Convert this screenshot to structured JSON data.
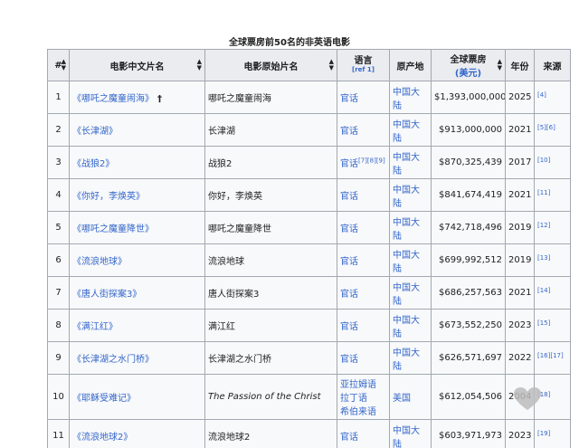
{
  "caption": "全球票房前50名的非英语电影",
  "headers": {
    "num": "#",
    "cn_title": "电影中文片名",
    "orig_title": "电影原始片名",
    "lang": "语言",
    "lang_ref": "[ref 1]",
    "country": "原产地",
    "gross": "全球票房",
    "gross_unit": "(美元)",
    "year": "年份",
    "source": "来源"
  },
  "rows": [
    {
      "n": "1",
      "cn": "《哪吒之魔童闹海》",
      "dagger": "†",
      "orig": "哪吒之魔童闹海",
      "lang": "官话",
      "lang_ref": "",
      "country": "中国大陆",
      "gross": "$1,393,000,000",
      "year": "2025",
      "ref": "[4]"
    },
    {
      "n": "2",
      "cn": "《长津湖》",
      "dagger": "",
      "orig": "长津湖",
      "lang": "官话",
      "lang_ref": "",
      "country": "中国大陆",
      "gross": "$913,000,000",
      "year": "2021",
      "ref": "[5][6]"
    },
    {
      "n": "3",
      "cn": "《战狼2》",
      "dagger": "",
      "orig": "战狼2",
      "lang": "官话",
      "lang_ref": "[7][8][9]",
      "country": "中国大陆",
      "gross": "$870,325,439",
      "year": "2017",
      "ref": "[10]"
    },
    {
      "n": "4",
      "cn": "《你好，李焕英》",
      "dagger": "",
      "orig": "你好，李焕英",
      "lang": "官话",
      "lang_ref": "",
      "country": "中国大陆",
      "gross": "$841,674,419",
      "year": "2021",
      "ref": "[11]"
    },
    {
      "n": "5",
      "cn": "《哪吒之魔童降世》",
      "dagger": "",
      "orig": "哪吒之魔童降世",
      "lang": "官话",
      "lang_ref": "",
      "country": "中国大陆",
      "gross": "$742,718,496",
      "year": "2019",
      "ref": "[12]"
    },
    {
      "n": "6",
      "cn": "《流浪地球》",
      "dagger": "",
      "orig": "流浪地球",
      "lang": "官话",
      "lang_ref": "",
      "country": "中国大陆",
      "gross": "$699,992,512",
      "year": "2019",
      "ref": "[13]"
    },
    {
      "n": "7",
      "cn": "《唐人街探案3》",
      "dagger": "",
      "orig": "唐人街探案3",
      "lang": "官话",
      "lang_ref": "",
      "country": "中国大陆",
      "gross": "$686,257,563",
      "year": "2021",
      "ref": "[14]"
    },
    {
      "n": "8",
      "cn": "《满江红》",
      "dagger": "",
      "orig": "满江红",
      "lang": "官话",
      "lang_ref": "",
      "country": "中国大陆",
      "gross": "$673,552,250",
      "year": "2023",
      "ref": "[15]"
    },
    {
      "n": "9",
      "cn": "《长津湖之水门桥》",
      "dagger": "",
      "orig": "长津湖之水门桥",
      "lang": "官话",
      "lang_ref": "",
      "country": "中国大陆",
      "gross": "$626,571,697",
      "year": "2022",
      "ref": "[16][17]"
    },
    {
      "n": "10",
      "cn": "《耶稣受难记》",
      "dagger": "",
      "orig": "The Passion of the Christ",
      "lang": "亚拉姆语\n拉丁语\n希伯来语",
      "lang_ref": "",
      "country": "美国",
      "gross": "$612,054,506",
      "year": "2004",
      "ref": "[18]"
    },
    {
      "n": "11",
      "cn": "《流浪地球2》",
      "dagger": "",
      "orig": "流浪地球2",
      "lang": "官话",
      "lang_ref": "",
      "country": "中国大陆",
      "gross": "$603,971,973",
      "year": "2023",
      "ref": "[19]"
    }
  ],
  "colors": {
    "link": "#3366cc",
    "header_bg": "#eaecf0",
    "highlight": "#cff5c8",
    "border": "#a2a9b1"
  }
}
